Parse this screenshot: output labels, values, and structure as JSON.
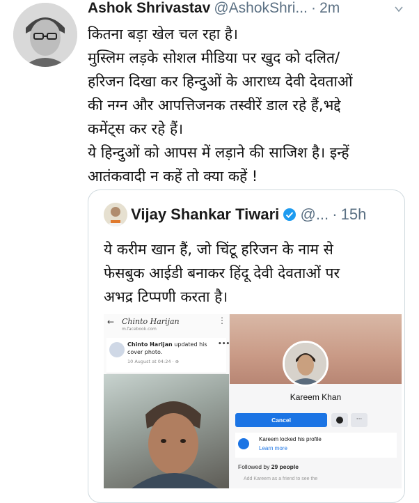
{
  "tweet": {
    "author_name": "Ashok Shrivastav",
    "author_handle": "@AshokShri...",
    "separator": "·",
    "time": "2m",
    "lines": [
      "कितना बड़ा खेल चल रहा है।",
      "मुस्लिम लड़के सोशल मीडिया पर खुद को दलित/",
      "हरिजन दिखा कर हिन्दुओं के आराध्य देवी देवताओं",
      "की नग्न और आपत्तिजनक तस्वीरें डाल रहे हैं,भद्दे",
      "कमेंट्स कर रहे हैं।",
      "ये हिन्दुओं को आपस में लड़ाने की साजिश है। इन्हें",
      "आतंकवादी न कहें तो क्या कहें !"
    ]
  },
  "quoted": {
    "author_name": "Vijay Shankar Tiwari",
    "author_handle": "@...",
    "separator": "·",
    "time": "15h",
    "lines": [
      "ये करीम खान हैं, जो चिंटू हरिजन के नाम से",
      "फेसबुक आईडी बनाकर हिंदू देवी देवताओं पर",
      "अभद्र टिप्पणी करता है।"
    ]
  },
  "screenshot_left": {
    "back": "←",
    "title": "Chinto Harijan",
    "url": "m.facebook.com",
    "menu": "⋮",
    "post_author": "Chinto Harijan",
    "post_action": "updated his cover photo.",
    "post_date": "10 August at 04:24 · ⊕",
    "post_menu": "•••"
  },
  "screenshot_right": {
    "profile_name": "Kareem Khan",
    "cancel_label": "Cancel",
    "more": "···",
    "locked_text": "Kareem locked his profile",
    "learn_more": "Learn more",
    "followed_prefix": "Followed by",
    "followed_count": "29 people",
    "add_text": "Add Kareem as a friend to see the"
  },
  "colors": {
    "accent": "#1b74e4",
    "verified": "#1d9bf0",
    "muted": "#5b7083"
  }
}
